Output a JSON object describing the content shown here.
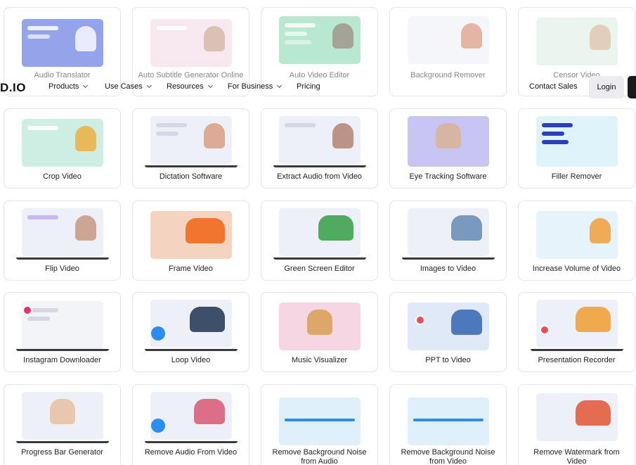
{
  "nav": {
    "logo": "D.IO",
    "items": [
      "Products",
      "Use Cases",
      "Resources",
      "For Business",
      "Pricing"
    ],
    "contact_sales": "Contact Sales",
    "login": "Login"
  },
  "cards": [
    {
      "title": "Audio Translator",
      "thumb": "#3d5ad9",
      "accent": "#e9ecff"
    },
    {
      "title": "Auto Subtitle Generator Online",
      "thumb": "#f3d8e6",
      "accent": "#b58a6a"
    },
    {
      "title": "Auto Video Editor",
      "thumb": "#7fd6a8",
      "accent": "#5a4a3a"
    },
    {
      "title": "Background Remover",
      "thumb": "#eef0f7",
      "accent": "#c86b4b"
    },
    {
      "title": "Censor Video",
      "thumb": "#d9eee2",
      "accent": "#caa07a"
    },
    {
      "title": "Crop Video",
      "thumb": "#cfeee3",
      "accent": "#e8b34b"
    },
    {
      "title": "Dictation Software",
      "thumb": "#eef0f7",
      "accent": "#d9a28a"
    },
    {
      "title": "Extract Audio from Video",
      "thumb": "#eef0f7",
      "accent": "#b5897a"
    },
    {
      "title": "Eye Tracking Software",
      "thumb": "#c9c5f2",
      "accent": "#d8b39a"
    },
    {
      "title": "Filler Remover",
      "thumb": "#dff3fb",
      "accent": "#2d3fb8"
    },
    {
      "title": "Flip Video",
      "thumb": "#eef0f7",
      "accent": "#c89c8a"
    },
    {
      "title": "Frame Video",
      "thumb": "#f5d3c1",
      "accent": "#f06a1f"
    },
    {
      "title": "Green Screen Editor",
      "thumb": "#eef0f7",
      "accent": "#3fa34d"
    },
    {
      "title": "Images to Video",
      "thumb": "#eef0f7",
      "accent": "#6b8fb8"
    },
    {
      "title": "Increase Volume of Video",
      "thumb": "#e6f3fb",
      "accent": "#f0a346"
    },
    {
      "title": "Instagram Downloader",
      "thumb": "#f3f4f7",
      "accent": "#e1306c"
    },
    {
      "title": "Loop Video",
      "thumb": "#eef0f7",
      "accent": "#2a3d5a"
    },
    {
      "title": "Music Visualizer",
      "thumb": "#f7d6e3",
      "accent": "#d9a25c"
    },
    {
      "title": "PPT to Video",
      "thumb": "#dfe9f7",
      "accent": "#3c6bb5"
    },
    {
      "title": "Presentation Recorder",
      "thumb": "#eef0f7",
      "accent": "#f0a13a"
    },
    {
      "title": "Progress Bar Generator",
      "thumb": "#eef0f7",
      "accent": "#e7c2a6"
    },
    {
      "title": "Remove Audio From Video",
      "thumb": "#eef0f7",
      "accent": "#d9607a"
    },
    {
      "title": "Remove Background Noise from Audio",
      "thumb": "#dff0fb",
      "accent": "#2d8cf0"
    },
    {
      "title": "Remove Background Noise from Video",
      "thumb": "#dff0fb",
      "accent": "#2d8cf0"
    },
    {
      "title": "Remove Watermark from Video",
      "thumb": "#eef0f7",
      "accent": "#e25d3f"
    }
  ]
}
